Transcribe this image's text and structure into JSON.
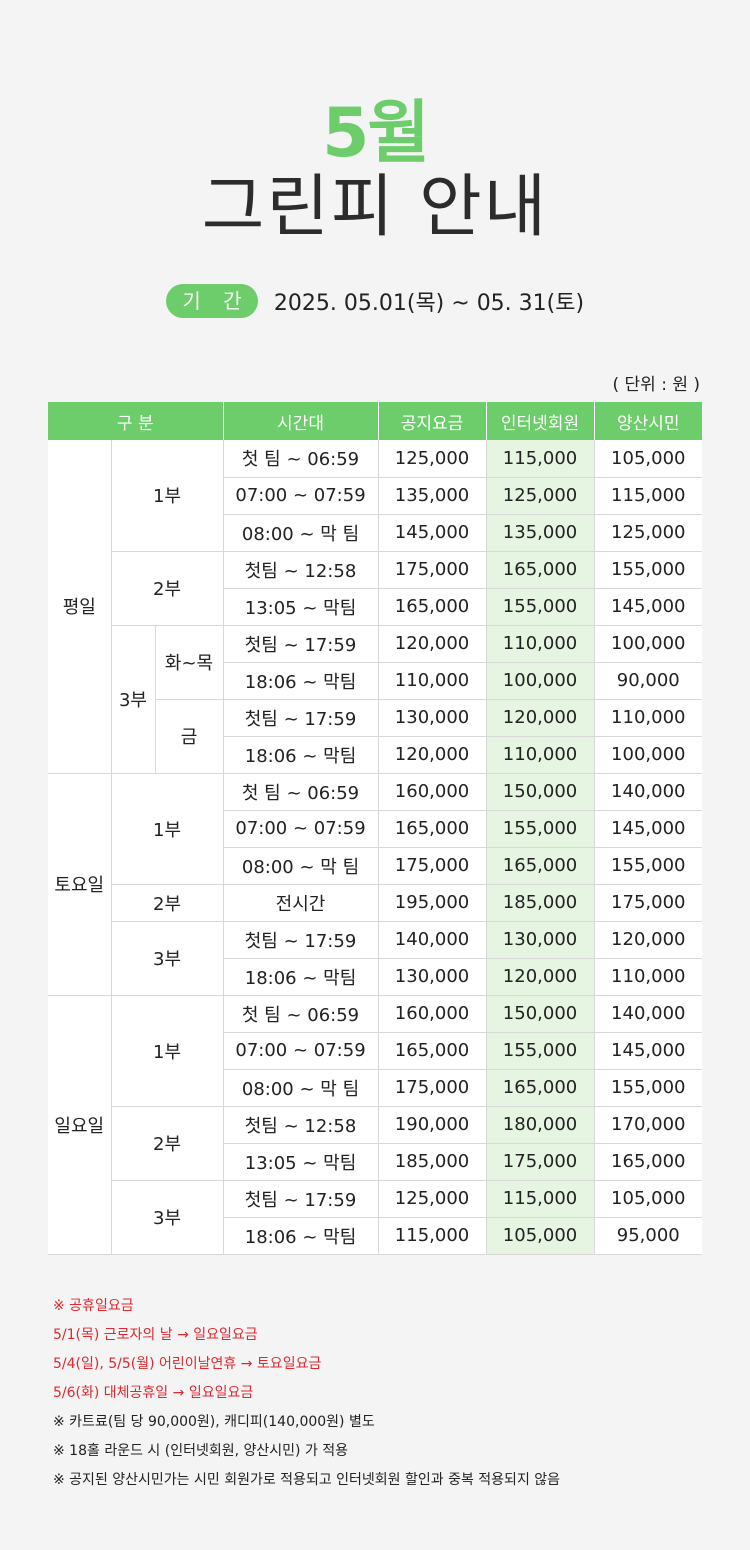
{
  "header": {
    "month": "5월",
    "title": "그린피 안내",
    "period_label": "기 간",
    "period_value": "2025. 05.01(목) ~ 05. 31(토)"
  },
  "unit": "( 단위 : 원 )",
  "table": {
    "headers": [
      "구 분",
      "시간대",
      "공지요금",
      "인터넷회원",
      "양산시민"
    ],
    "groups": {
      "weekday": "평일",
      "saturday": "토요일",
      "sunday": "일요일"
    },
    "parts": {
      "p1": "1부",
      "p2": "2부",
      "p3": "3부",
      "tue_thu": "화~목",
      "fri": "금"
    },
    "rows": [
      {
        "time": "첫 팀 ~ 06:59",
        "notice": "125,000",
        "internet": "115,000",
        "citizen": "105,000"
      },
      {
        "time": "07:00 ~ 07:59",
        "notice": "135,000",
        "internet": "125,000",
        "citizen": "115,000"
      },
      {
        "time": "08:00 ~ 막 팀",
        "notice": "145,000",
        "internet": "135,000",
        "citizen": "125,000"
      },
      {
        "time": "첫팀 ~ 12:58",
        "notice": "175,000",
        "internet": "165,000",
        "citizen": "155,000"
      },
      {
        "time": "13:05 ~ 막팀",
        "notice": "165,000",
        "internet": "155,000",
        "citizen": "145,000"
      },
      {
        "time": "첫팀 ~ 17:59",
        "notice": "120,000",
        "internet": "110,000",
        "citizen": "100,000"
      },
      {
        "time": "18:06 ~ 막팀",
        "notice": "110,000",
        "internet": "100,000",
        "citizen": "90,000"
      },
      {
        "time": "첫팀 ~ 17:59",
        "notice": "130,000",
        "internet": "120,000",
        "citizen": "110,000"
      },
      {
        "time": "18:06 ~ 막팀",
        "notice": "120,000",
        "internet": "110,000",
        "citizen": "100,000"
      },
      {
        "time": "첫 팀 ~ 06:59",
        "notice": "160,000",
        "internet": "150,000",
        "citizen": "140,000"
      },
      {
        "time": "07:00 ~ 07:59",
        "notice": "165,000",
        "internet": "155,000",
        "citizen": "145,000"
      },
      {
        "time": "08:00 ~ 막 팀",
        "notice": "175,000",
        "internet": "165,000",
        "citizen": "155,000"
      },
      {
        "time": "전시간",
        "notice": "195,000",
        "internet": "185,000",
        "citizen": "175,000"
      },
      {
        "time": "첫팀 ~ 17:59",
        "notice": "140,000",
        "internet": "130,000",
        "citizen": "120,000"
      },
      {
        "time": "18:06 ~ 막팀",
        "notice": "130,000",
        "internet": "120,000",
        "citizen": "110,000"
      },
      {
        "time": "첫 팀 ~ 06:59",
        "notice": "160,000",
        "internet": "150,000",
        "citizen": "140,000"
      },
      {
        "time": "07:00 ~ 07:59",
        "notice": "165,000",
        "internet": "155,000",
        "citizen": "145,000"
      },
      {
        "time": "08:00 ~ 막 팀",
        "notice": "175,000",
        "internet": "165,000",
        "citizen": "155,000"
      },
      {
        "time": "첫팀 ~ 12:58",
        "notice": "190,000",
        "internet": "180,000",
        "citizen": "170,000"
      },
      {
        "time": "13:05 ~ 막팀",
        "notice": "185,000",
        "internet": "175,000",
        "citizen": "165,000"
      },
      {
        "time": "첫팀 ~ 17:59",
        "notice": "125,000",
        "internet": "115,000",
        "citizen": "105,000"
      },
      {
        "time": "18:06 ~ 막팀",
        "notice": "115,000",
        "internet": "105,000",
        "citizen": "95,000"
      }
    ]
  },
  "notes": [
    {
      "text": "※ 공휴일요금",
      "color": "#e0282e"
    },
    {
      "text": "5/1(목) 근로자의 날 → 일요일요금",
      "color": "#e0282e"
    },
    {
      "text": "5/4(일), 5/5(월) 어린이날연휴 → 토요일요금",
      "color": "#e0282e"
    },
    {
      "text": "5/6(화) 대체공휴일 → 일요일요금",
      "color": "#e0282e"
    },
    {
      "text": "※ 카트료(팀 당 90,000원), 캐디피(140,000원) 별도",
      "color": "#222222"
    },
    {
      "text": "※ 18홀 라운드 시 (인터넷회원, 양산시민) 가 적용",
      "color": "#222222"
    },
    {
      "text": "※ 공지된 양산시민가는 시민 회원가로 적용되고 인터넷회원 할인과 중복 적용되지 않음",
      "color": "#222222"
    }
  ]
}
